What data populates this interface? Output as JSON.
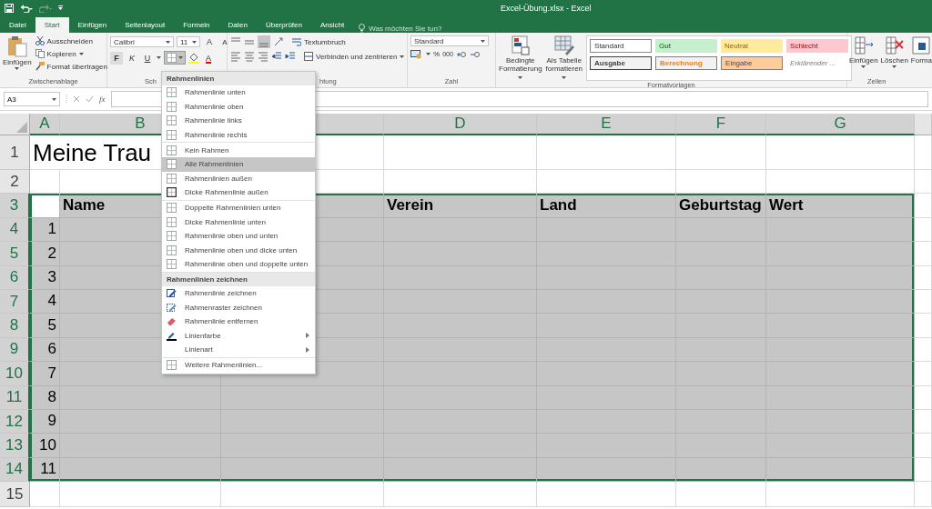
{
  "title_bar": {
    "title": "Excel-Übung.xlsx - Excel"
  },
  "tabs": [
    {
      "label": "Datei",
      "selected": false
    },
    {
      "label": "Start",
      "selected": true
    },
    {
      "label": "Einfügen",
      "selected": false
    },
    {
      "label": "Seitenlayout",
      "selected": false
    },
    {
      "label": "Formeln",
      "selected": false
    },
    {
      "label": "Daten",
      "selected": false
    },
    {
      "label": "Überprüfen",
      "selected": false
    },
    {
      "label": "Ansicht",
      "selected": false
    }
  ],
  "tell_me": {
    "placeholder": "Was möchten Sie tun?"
  },
  "ribbon": {
    "clipboard": {
      "paste": "Einfügen",
      "cut": "Ausschneiden",
      "copy": "Kopieren",
      "format_painter": "Format übertragen",
      "label": "Zwischenablage"
    },
    "font": {
      "name": "Calibri",
      "size": "11",
      "grow": "A",
      "shrink": "A",
      "bold": "F",
      "italic": "K",
      "underline": "U",
      "font_color": "A",
      "label": "Sch"
    },
    "alignment": {
      "wrap": "Textumbruch",
      "merge": "Verbinden und zentrieren",
      "label": "htung"
    },
    "number": {
      "format": "Standard",
      "percent": "%",
      "thousands": "000",
      "label": "Zahl"
    },
    "styles": {
      "conditional": "Bedingte Formatierung",
      "table": "Als Tabelle formatieren",
      "label": "Formatvorlagen",
      "gallery": [
        {
          "label": "Standard",
          "kind": "normal"
        },
        {
          "label": "Gut",
          "kind": "good"
        },
        {
          "label": "Neutral",
          "kind": "neutral"
        },
        {
          "label": "Schlecht",
          "kind": "bad"
        },
        {
          "label": "Ausgabe",
          "kind": "output"
        },
        {
          "label": "Berechnung",
          "kind": "calculation"
        },
        {
          "label": "Eingabe",
          "kind": "input"
        },
        {
          "label": "Erklärender ...",
          "kind": "explanatory"
        }
      ]
    },
    "cells": {
      "insert": "Einfügen",
      "delete": "Löschen",
      "format": "Forma",
      "label": "Zellen"
    }
  },
  "formula_bar": {
    "name_box": "A3",
    "function": "fx"
  },
  "sheet": {
    "columns": [
      {
        "label": "A",
        "selected": true
      },
      {
        "label": "B",
        "selected": true
      },
      {
        "selected": true
      },
      {
        "label": "D",
        "selected": true
      },
      {
        "label": "E",
        "selected": true
      },
      {
        "label": "F",
        "selected": true
      },
      {
        "label": "G",
        "selected": true
      }
    ],
    "rows": [
      {
        "header": "1",
        "selected": false,
        "kind": "title",
        "cells": [
          "Meine Trau"
        ]
      },
      {
        "header": "2",
        "selected": false,
        "kind": "plain",
        "cells": []
      },
      {
        "header": "3",
        "selected": true,
        "active": true,
        "kind": "heading",
        "cells": [
          "",
          "Name",
          "",
          "Verein",
          "Land",
          "Geburtstag",
          "Wert"
        ]
      },
      {
        "header": "4",
        "selected": true,
        "kind": "number",
        "cells": [
          "1"
        ]
      },
      {
        "header": "5",
        "selected": true,
        "kind": "number",
        "cells": [
          "2"
        ]
      },
      {
        "header": "6",
        "selected": true,
        "kind": "number",
        "cells": [
          "3"
        ]
      },
      {
        "header": "7",
        "selected": true,
        "kind": "number",
        "cells": [
          "4"
        ]
      },
      {
        "header": "8",
        "selected": true,
        "kind": "number",
        "cells": [
          "5"
        ]
      },
      {
        "header": "9",
        "selected": true,
        "kind": "number",
        "cells": [
          "6"
        ]
      },
      {
        "header": "10",
        "selected": true,
        "kind": "number",
        "cells": [
          "7"
        ]
      },
      {
        "header": "11",
        "selected": true,
        "kind": "number",
        "cells": [
          "8"
        ]
      },
      {
        "header": "12",
        "selected": true,
        "kind": "number",
        "cells": [
          "9"
        ]
      },
      {
        "header": "13",
        "selected": true,
        "kind": "number",
        "cells": [
          "10"
        ]
      },
      {
        "header": "14",
        "selected": true,
        "kind": "number",
        "cells": [
          "11"
        ]
      },
      {
        "header": "15",
        "selected": false,
        "kind": "plain",
        "cells": []
      }
    ]
  },
  "border_menu": {
    "sections": [
      {
        "header": "Rahmenlinien",
        "groups": [
          [
            {
              "label": "Rahmenlinie unten",
              "kind": "border",
              "selected": false,
              "submenu": false
            },
            {
              "label": "Rahmenlinie oben",
              "kind": "border",
              "selected": false,
              "submenu": false
            },
            {
              "label": "Rahmenlinie links",
              "kind": "border",
              "selected": false,
              "submenu": false
            },
            {
              "label": "Rahmenlinie rechts",
              "kind": "border",
              "selected": false,
              "submenu": false
            }
          ],
          [
            {
              "label": "Kein Rahmen",
              "kind": "border",
              "selected": false,
              "submenu": false
            },
            {
              "label": "Alle Rahmenlinien",
              "kind": "border",
              "selected": true,
              "submenu": false
            },
            {
              "label": "Rahmenlinien außen",
              "kind": "border",
              "selected": false,
              "submenu": false
            },
            {
              "label": "Dicke Rahmenlinie außen",
              "kind": "thick-border",
              "selected": false,
              "submenu": false
            }
          ],
          [
            {
              "label": "Doppelte Rahmenlinien unten",
              "kind": "border",
              "selected": false,
              "submenu": false
            },
            {
              "label": "Dicke Rahmenlinie unten",
              "kind": "border",
              "selected": false,
              "submenu": false
            },
            {
              "label": "Rahmenlinie oben und unten",
              "kind": "border",
              "selected": false,
              "submenu": false
            },
            {
              "label": "Rahmenlinie oben und dicke unten",
              "kind": "border",
              "selected": false,
              "submenu": false
            },
            {
              "label": "Rahmenlinie oben und doppelte unten",
              "kind": "border",
              "selected": false,
              "submenu": false
            }
          ]
        ]
      },
      {
        "header": "Rahmenlinien zeichnen",
        "groups": [
          [
            {
              "label": "Rahmenlinie zeichnen",
              "kind": "draw",
              "selected": false,
              "submenu": false
            },
            {
              "label": "Rahmenraster zeichnen",
              "kind": "draw-grid",
              "selected": false,
              "submenu": false
            },
            {
              "label": "Rahmenlinie entfernen",
              "kind": "erase",
              "selected": false,
              "submenu": false
            },
            {
              "label": "Linienfarbe",
              "kind": "line-color",
              "selected": false,
              "submenu": true
            },
            {
              "label": "Linienart",
              "kind": "plain",
              "selected": false,
              "submenu": true
            }
          ],
          [
            {
              "label": "Weitere Rahmenlinien...",
              "kind": "border",
              "selected": false,
              "submenu": false
            }
          ]
        ]
      }
    ]
  }
}
